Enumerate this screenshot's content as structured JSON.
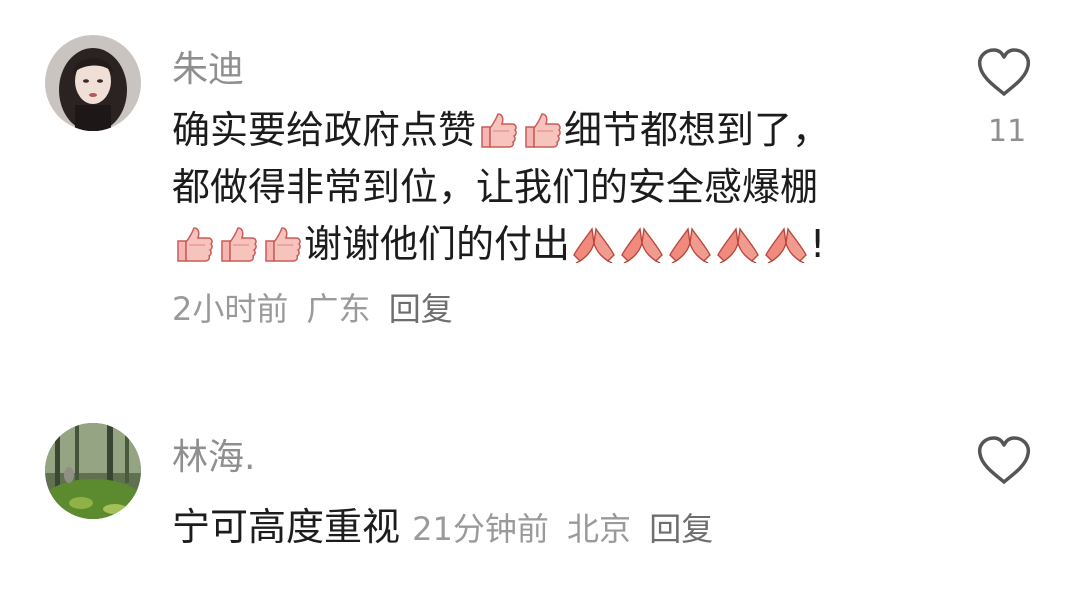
{
  "comments": [
    {
      "username": "朱迪",
      "text_segments": [
        "确实要给政府点赞",
        "细节都想到了，",
        "都做得非常到位，让我们的安全感爆棚",
        "谢谢他们的付出",
        "!"
      ],
      "meta": {
        "time": "2小时前",
        "location": "广东",
        "reply": "回复"
      },
      "likes": "11",
      "avatar_icon": "woman-portrait-avatar",
      "emojis": [
        "thumbs-up",
        "praying-hands"
      ]
    },
    {
      "username": "林海.",
      "text": "宁可高度重视",
      "meta": {
        "time": "21分钟前",
        "location": "北京",
        "reply": "回复"
      },
      "avatar_icon": "forest-avatar"
    }
  ],
  "colors": {
    "username": "#8f8f8f",
    "text": "#1c1c1c",
    "meta": "#9a9a9a",
    "heart_outline": "#555555",
    "emoji_thumb": "#f2a0a0",
    "emoji_pray": "#e8796f"
  }
}
